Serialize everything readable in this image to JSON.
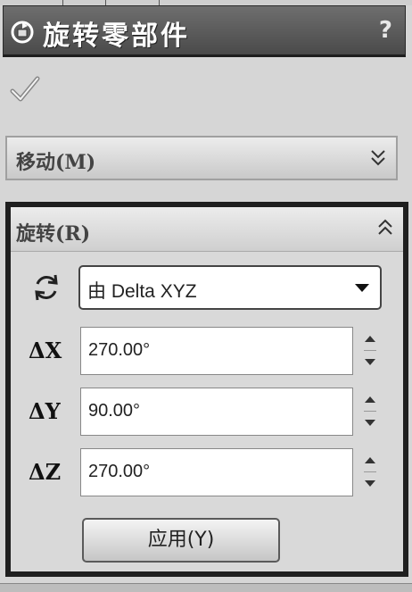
{
  "panel": {
    "title": "旋转零部件",
    "help": "?"
  },
  "icons": {
    "title": "rotate-component-icon",
    "confirm": "checkmark-icon",
    "rotate": "rotate-arrows-icon",
    "expand": "chevron-double-down-icon",
    "collapse": "chevron-double-up-icon"
  },
  "move_group": {
    "label": "移动(M)"
  },
  "rotate_group": {
    "label": "旋转(R)",
    "mode_selected": "由 Delta XYZ",
    "fields": [
      {
        "label": "ΔX",
        "value": "270.00°"
      },
      {
        "label": "ΔY",
        "value": "90.00°"
      },
      {
        "label": "ΔZ",
        "value": "270.00°"
      }
    ],
    "apply_label": "应用(Y)"
  }
}
